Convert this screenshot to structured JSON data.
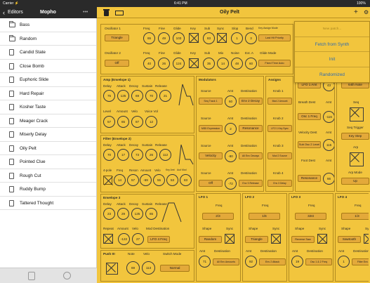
{
  "status": {
    "carrier": "Carrier ⚡",
    "time": "6:41 PM",
    "battery": "100%"
  },
  "nav": {
    "back_label": "Editors",
    "device_title": "Mopho",
    "title": "Oily Pelt"
  },
  "sidebar": {
    "items": [
      {
        "label": "Bass",
        "kind": "folder"
      },
      {
        "label": "Random",
        "kind": "folder"
      },
      {
        "label": "Candid State",
        "kind": "doc"
      },
      {
        "label": "Close Bomb",
        "kind": "doc"
      },
      {
        "label": "Euphoric Slide",
        "kind": "doc"
      },
      {
        "label": "Hard Repair",
        "kind": "doc"
      },
      {
        "label": "Kosher Taste",
        "kind": "doc"
      },
      {
        "label": "Meager Crack",
        "kind": "doc"
      },
      {
        "label": "Miserly Delay",
        "kind": "doc"
      },
      {
        "label": "Oily Pelt",
        "kind": "doc"
      },
      {
        "label": "Pointed Clue",
        "kind": "doc"
      },
      {
        "label": "Rough Cut",
        "kind": "doc"
      },
      {
        "label": "Ruddy Bump",
        "kind": "doc"
      },
      {
        "label": "Tattered Thought",
        "kind": "doc"
      }
    ]
  },
  "popover": {
    "items": [
      "New patch...",
      "Fetch from Synth",
      "Init",
      "Randomized"
    ]
  },
  "osc": {
    "osc1": "Oscillator 1",
    "osc2": "Oscillator 2",
    "freq": "Freq",
    "fine": "Fine",
    "glide": "Glide",
    "key": "Key",
    "sub": "Sub",
    "sync": "Sync",
    "slop": "Slop",
    "bend": "Bend",
    "keyassign": "Key Assign Mode",
    "mix": "Mix",
    "noise": "Noise",
    "ext": "Ext. A",
    "glidemode": "Glide Mode",
    "row1": {
      "shape": "Triangle",
      "freq": "65",
      "fine": "49",
      "glide": "103",
      "sub": "83",
      "slop": "1",
      "bend": "3",
      "mode": "Last Hit Priority"
    },
    "row2": {
      "shape": "Off",
      "freq": "40",
      "fine": "26",
      "glide": "124",
      "sub": "35",
      "mix": "14",
      "noise": "48",
      "ext": "60",
      "mode": "Fixed Time Auto"
    }
  },
  "amp": {
    "title": "Amp (Envelope 1)",
    "labels": [
      "Delay",
      "Attack",
      "Decay",
      "Sustain",
      "Release"
    ],
    "values": [
      "75",
      "125",
      "69",
      "70",
      "21"
    ],
    "labels2": [
      "Level",
      "Amount",
      "Velo",
      "Voice Vol"
    ],
    "values2": [
      "57",
      "65",
      "87",
      "12"
    ]
  },
  "filter": {
    "title": "Filter (Envelope 2)",
    "labels": [
      "Delay",
      "Attack",
      "Decay",
      "Sustain",
      "Release"
    ],
    "values": [
      "70",
      "17",
      "73",
      "26",
      "112"
    ],
    "labels2": [
      "4-pole",
      "Freq",
      "Reson",
      "Amount",
      "Velo",
      "Key Amt",
      "Aud Mod"
    ],
    "values2": [
      "14",
      "57",
      "-69",
      "55",
      "53",
      "83"
    ]
  },
  "env3": {
    "title": "Envelope 3",
    "labels": [
      "Delay",
      "Attack",
      "Decay",
      "Sustain",
      "Release"
    ],
    "values": [
      "23",
      "29",
      "125",
      "65"
    ],
    "labels2": [
      "Repeat",
      "Amount",
      "Velo",
      "Mod Destination"
    ],
    "values2": [
      "-122",
      "27"
    ],
    "dest": "LFO 4 Freq"
  },
  "pushit": {
    "title": "Push It!",
    "labels": [
      "Note",
      "Velo",
      "Switch Mode"
    ],
    "values": [
      "69",
      "113"
    ],
    "mode": "Normal"
  },
  "mod": {
    "title": "Modulators",
    "labels": [
      "Source",
      "Amt",
      "Destination"
    ],
    "rows": [
      {
        "src": "Seq Track 1",
        "amt": "60",
        "dest": "Env 2 Decay"
      },
      {
        "src": "MIDI Expression",
        "amt": "2",
        "dest": "Resonance"
      },
      {
        "src": "Velocity",
        "amt": "-80",
        "dest": "All Env Decays"
      },
      {
        "src": "Off",
        "amt": "-72",
        "dest": "Env 3 Release"
      }
    ]
  },
  "assigns": {
    "title": "Assigns",
    "rows": [
      {
        "label": "Knob 1",
        "val": "Mod 2 Amount"
      },
      {
        "label": "Knob 2",
        "val": "LFO 1 Key Sync"
      },
      {
        "label": "Knob 3",
        "val": "Mod 2 Source"
      },
      {
        "label": "Knob 4",
        "val": "Env 3 Delay"
      }
    ]
  },
  "right": {
    "lfo1amt": "LFO 1 Amt",
    "lfo1val": "43",
    "breath": "Breath Dest",
    "amt": "Amt",
    "osc1freq": "Osc 1 Freq",
    "osc1val": "-116",
    "velo": "Velocity Dest",
    "sub": "Sub Osc 2 Level",
    "subval": "115",
    "foot": "Foot Dest",
    "res": "Resonance",
    "resval": "66",
    "seq": "Seq",
    "btn1": "64th Note",
    "trig": "Seq Trigger",
    "keystep": "Key Step",
    "arp": "Arp",
    "arpmode": "Arp Mode",
    "up": "Up"
  },
  "lfo": [
    {
      "title": "LFO 1",
      "freq": "2/3",
      "shape": "Random",
      "dest": "All Env Amounts",
      "amt": "71"
    },
    {
      "title": "LFO 2",
      "freq": "1/6",
      "shape": "Triangle",
      "dest": "Env 2 Attack",
      "amt": "92"
    },
    {
      "title": "LFO 3",
      "freq": "32st",
      "shape": "Reverse Saw",
      "dest": "Osc 1 & 2 Freq",
      "amt": "19"
    },
    {
      "title": "LFO 4",
      "freq": "1/3",
      "shape": "Sawtooth",
      "dest": "Filter Env Amt",
      "amt": "1"
    }
  ],
  "lfo_labels": {
    "freq": "Freq",
    "shape": "Shape",
    "sync": "Sync",
    "amt": "Amt",
    "dest": "Destination"
  }
}
